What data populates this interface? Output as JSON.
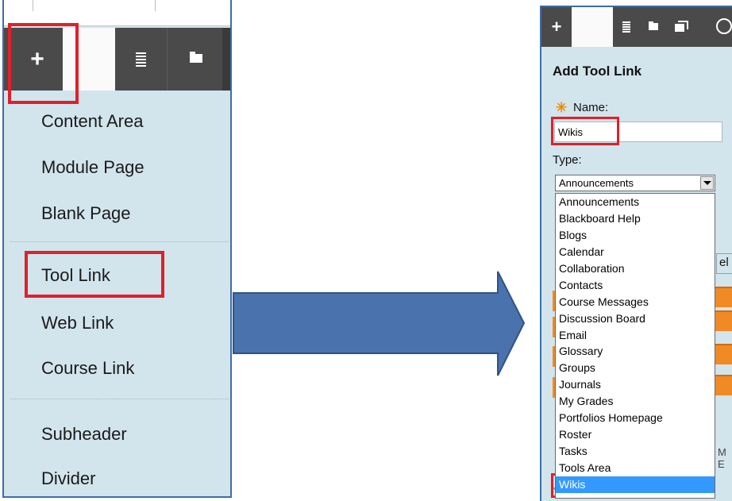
{
  "left_panel": {
    "toolbar": {
      "add_symbol": "+"
    },
    "menu_items": [
      "Content Area",
      "Module Page",
      "Blank Page",
      "Tool Link",
      "Web Link",
      "Course Link",
      "Subheader",
      "Divider"
    ]
  },
  "right_panel": {
    "toolbar": {
      "add_symbol": "+"
    },
    "title": "Add Tool Link",
    "required_marker": "✳",
    "name_label": "Name:",
    "name_value": "Wikis",
    "type_label": "Type:",
    "type_selected": "Announcements",
    "type_options": [
      "Announcements",
      "Blackboard Help",
      "Blogs",
      "Calendar",
      "Collaboration",
      "Contacts",
      "Course Messages",
      "Discussion Board",
      "Email",
      "Glossary",
      "Groups",
      "Journals",
      "My Grades",
      "Portfolios Homepage",
      "Roster",
      "Tasks",
      "Tools Area",
      "Wikis"
    ],
    "highlighted_option": "Wikis",
    "partial_text_cancel": "el",
    "partial_text_me": "M E"
  },
  "colors": {
    "panel_bg": "#d2e4ec",
    "toolbar_bg": "#4a4a4a",
    "highlight_red": "#e0202a",
    "arrow_fill": "#4a72ad",
    "selection_blue": "#3399ff",
    "required_orange": "#f08a00",
    "button_orange": "#f08a25"
  },
  "icons": [
    "plus-icon",
    "list-icon",
    "folder-icon",
    "window-icon",
    "circle-icon",
    "dropdown-arrow-icon",
    "right-arrow-icon"
  ]
}
